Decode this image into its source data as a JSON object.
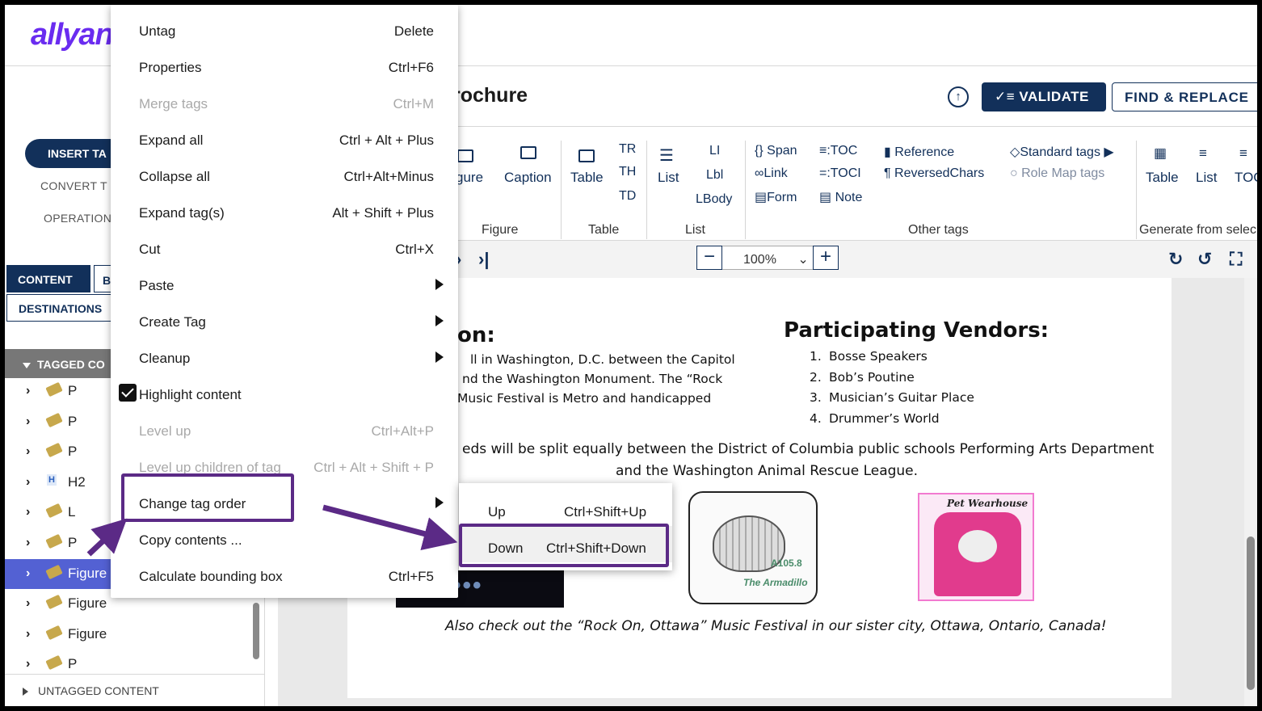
{
  "app": {
    "logo": "allyant"
  },
  "header": {
    "doc_title": "rochure",
    "validate_label": "VALIDATE",
    "find_replace_label": "FIND & REPLACE"
  },
  "left_panel": {
    "insert_tag_label": "INSERT TA",
    "convert_tag_label": "CONVERT T",
    "operations_label": "OPERATION",
    "tabs": {
      "content": "CONTENT",
      "b": "B",
      "destinations": "DESTINATIONS"
    },
    "tagged_content_label": "TAGGED CO",
    "tree": [
      {
        "label": "P",
        "icon": "tag-icon",
        "selected": false
      },
      {
        "label": "P",
        "icon": "tag-icon",
        "selected": false
      },
      {
        "label": "P",
        "icon": "tag-icon",
        "selected": false
      },
      {
        "label": "H2",
        "icon": "heading-icon",
        "selected": false
      },
      {
        "label": "L",
        "icon": "tag-icon",
        "selected": false
      },
      {
        "label": "P",
        "icon": "tag-icon",
        "selected": false
      },
      {
        "label": "Figure",
        "icon": "tag-icon",
        "selected": true
      },
      {
        "label": "Figure",
        "icon": "tag-icon",
        "selected": false
      },
      {
        "label": "Figure",
        "icon": "tag-icon",
        "selected": false
      },
      {
        "label": "P",
        "icon": "tag-icon",
        "selected": false
      }
    ],
    "untagged_content_label": "UNTAGGED CONTENT"
  },
  "ribbon": {
    "figure": "gure",
    "caption": "Caption",
    "figure_group": "Figure",
    "table": "Table",
    "tr": "TR",
    "th": "TH",
    "td": "TD",
    "table_group": "Table",
    "list": "List",
    "li": "LI",
    "lbl": "Lbl",
    "lbody": "LBody",
    "list_group": "List",
    "span": "Span",
    "link": "Link",
    "form": "Form",
    "toc": "TOC",
    "toci": "TOCI",
    "note": "Note",
    "reference": "Reference",
    "reversed_chars": "ReversedChars",
    "standard_tags": "Standard tags",
    "role_map_tags": "Role Map tags",
    "other_group": "Other tags",
    "gen_table": "Table",
    "gen_list": "List",
    "gen_toc": "TOC",
    "generate_group": "Generate from selec"
  },
  "viewer": {
    "zoom": "100%"
  },
  "document": {
    "heading_left": "on:",
    "para_lines": [
      "ll in Washington, D.C. between the Capitol",
      "nd the Washington Monument.  The “Rock",
      "Music Festival is Metro and handicapped"
    ],
    "vendors_title": "Participating Vendors:",
    "vendors": [
      {
        "num": "1.",
        "name": "Bosse Speakers"
      },
      {
        "num": "2.",
        "name": "Bob’s Poutine"
      },
      {
        "num": "3.",
        "name": "Musician’s Guitar Place"
      },
      {
        "num": "4.",
        "name": "Drummer’s World"
      }
    ],
    "proceeds_line1": "eds will be split equally between the District of Columbia public schools Performing Arts Department",
    "proceeds_line2": "and the Washington Animal Rescue League.",
    "armadillo_text1": "A105.8",
    "armadillo_text2": "The Armadillo",
    "pet_title": "Pet Wearhouse",
    "footer_line": "Also check out the “Rock On, Ottawa” Music Festival in our sister city, Ottawa, Ontario, Canada!"
  },
  "context_menu": {
    "items": [
      {
        "label": "Untag",
        "shortcut": "Delete",
        "disabled": false,
        "submenu": false
      },
      {
        "label": "Properties",
        "shortcut": "Ctrl+F6",
        "disabled": false,
        "submenu": false
      },
      {
        "label": "Merge tags",
        "shortcut": "Ctrl+M",
        "disabled": true,
        "submenu": false
      },
      {
        "label": "Expand all",
        "shortcut": "Ctrl + Alt + Plus",
        "disabled": false,
        "submenu": false
      },
      {
        "label": "Collapse all",
        "shortcut": "Ctrl+Alt+Minus",
        "disabled": false,
        "submenu": false
      },
      {
        "label": "Expand tag(s)",
        "shortcut": "Alt + Shift + Plus",
        "disabled": false,
        "submenu": false
      },
      {
        "label": "Cut",
        "shortcut": "Ctrl+X",
        "disabled": false,
        "submenu": false
      },
      {
        "label": "Paste",
        "shortcut": "",
        "disabled": false,
        "submenu": true
      },
      {
        "label": "Create Tag",
        "shortcut": "",
        "disabled": false,
        "submenu": true
      },
      {
        "label": "Cleanup",
        "shortcut": "",
        "disabled": false,
        "submenu": true
      },
      {
        "label": "Highlight content",
        "shortcut": "",
        "disabled": false,
        "submenu": false,
        "checked": true
      },
      {
        "label": "Level up",
        "shortcut": "Ctrl+Alt+P",
        "disabled": true,
        "submenu": false
      },
      {
        "label": "Level up children of tag",
        "shortcut": "Ctrl + Alt + Shift + P",
        "disabled": true,
        "submenu": false
      },
      {
        "label": "Change tag order",
        "shortcut": "",
        "disabled": false,
        "submenu": true
      },
      {
        "label": "Copy contents ...",
        "shortcut": "",
        "disabled": false,
        "submenu": false
      },
      {
        "label": "Calculate bounding box",
        "shortcut": "Ctrl+F5",
        "disabled": false,
        "submenu": false
      }
    ]
  },
  "submenu": {
    "items": [
      {
        "label": "Up",
        "shortcut": "Ctrl+Shift+Up"
      },
      {
        "label": "Down",
        "shortcut": "Ctrl+Shift+Down"
      }
    ]
  },
  "colors": {
    "brand": "#6a2cf0",
    "navy": "#12305a",
    "highlight": "#5b2a86",
    "selected_row": "#5361d3"
  }
}
